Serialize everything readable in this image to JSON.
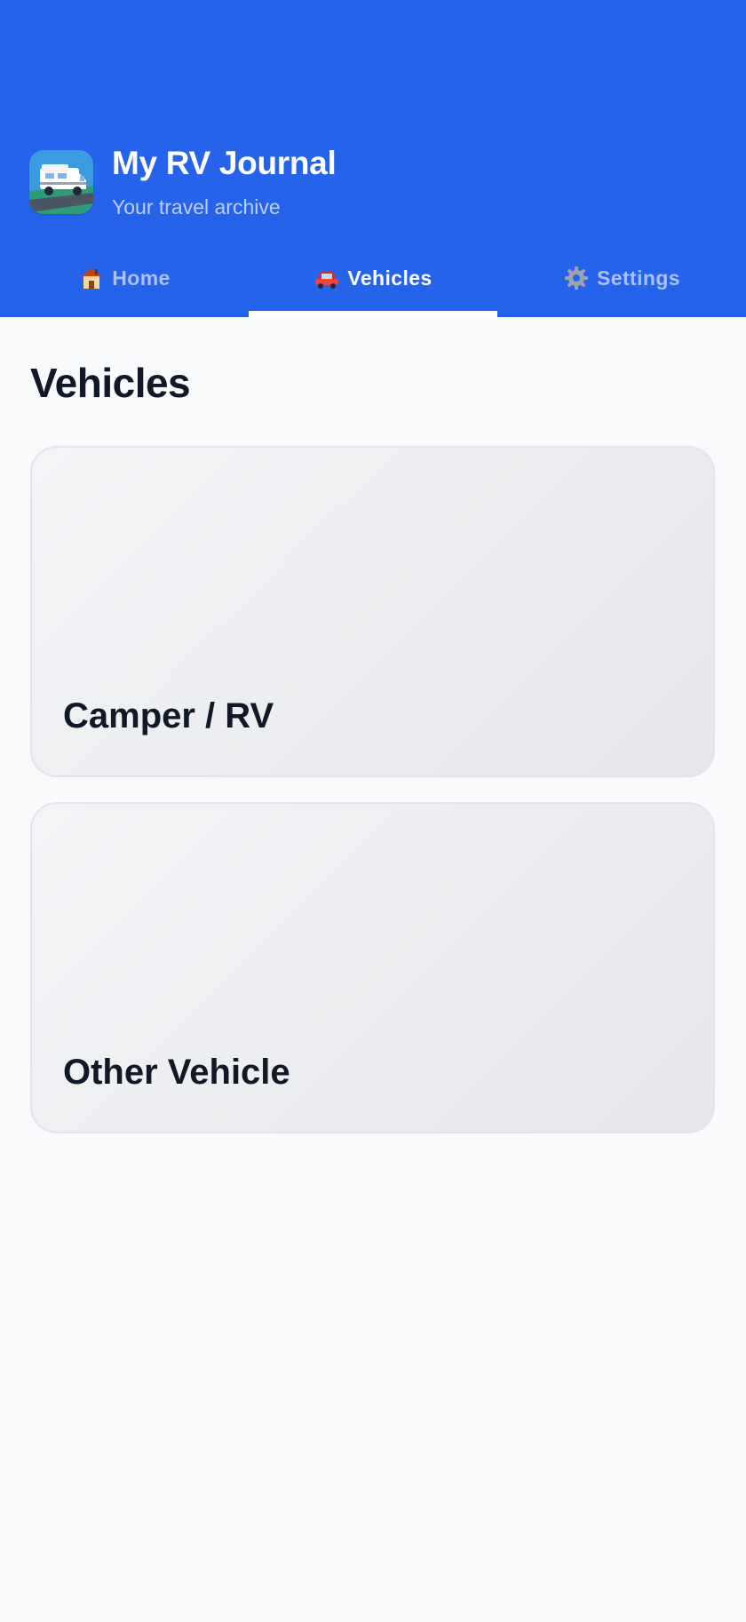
{
  "header": {
    "app_title": "My RV Journal",
    "app_subtitle": "Your travel archive",
    "app_icon": "camper-van-icon",
    "background_color": "#2563eb"
  },
  "tabs": [
    {
      "label": "Home",
      "icon": "house-icon",
      "active": false
    },
    {
      "label": "Vehicles",
      "icon": "red-car-icon",
      "active": true
    },
    {
      "label": "Settings",
      "icon": "gear-icon",
      "active": false
    }
  ],
  "main": {
    "title": "Vehicles",
    "cards": [
      {
        "label": "Camper / RV"
      },
      {
        "label": "Other Vehicle"
      }
    ]
  }
}
